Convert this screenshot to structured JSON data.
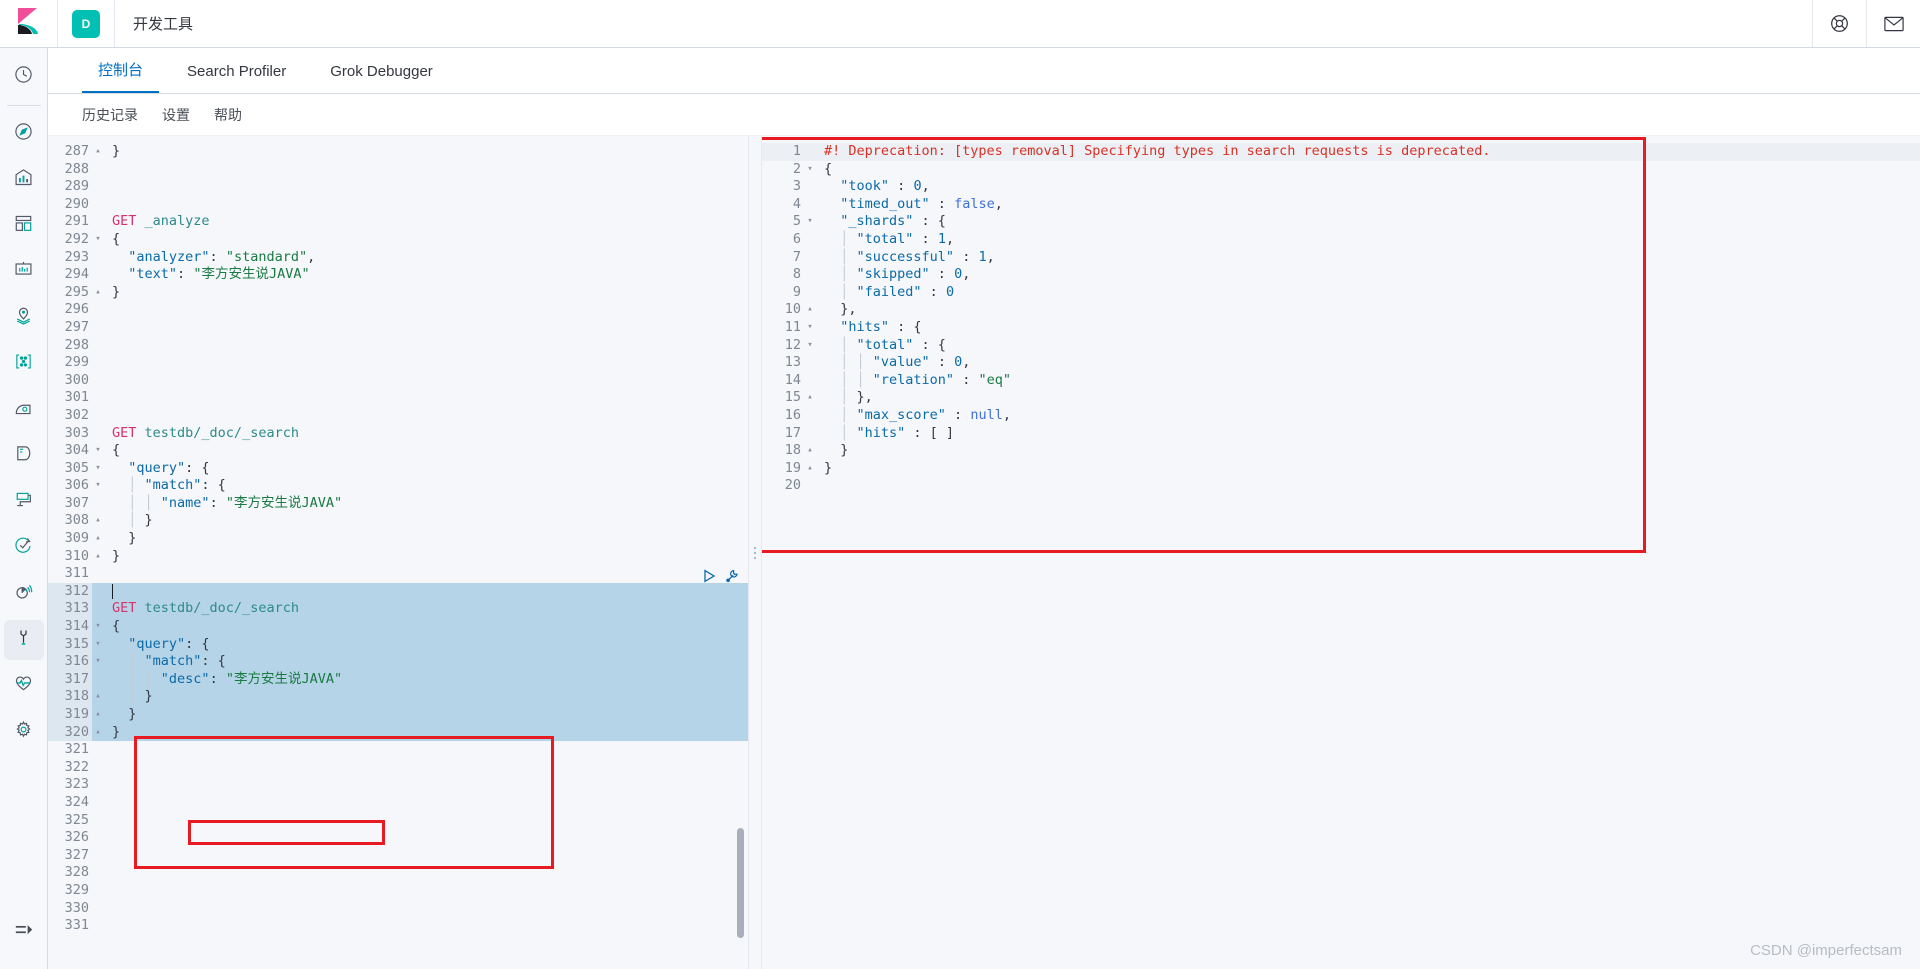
{
  "header": {
    "app_badge": "D",
    "app_title": "开发工具",
    "help_icon": "lifebuoy-icon",
    "mail_icon": "envelope-icon",
    "logo_icon": "kibana-logo-icon"
  },
  "rail": {
    "items": [
      {
        "name": "recently-viewed",
        "icon": "clock-icon"
      },
      {
        "name": "discover",
        "icon": "compass-icon"
      },
      {
        "name": "visualize",
        "icon": "bar-chart-icon"
      },
      {
        "name": "dashboard",
        "icon": "dashboard-grid-icon"
      },
      {
        "name": "canvas",
        "icon": "presentation-icon"
      },
      {
        "name": "maps",
        "icon": "map-pin-icon"
      },
      {
        "name": "machine-learning",
        "icon": "ml-nodes-icon"
      },
      {
        "name": "infrastructure",
        "icon": "infra-icon"
      },
      {
        "name": "logs",
        "icon": "logs-icon"
      },
      {
        "name": "apm",
        "icon": "apm-icon"
      },
      {
        "name": "uptime",
        "icon": "uptime-check-icon"
      },
      {
        "name": "siem",
        "icon": "siem-radar-icon"
      },
      {
        "name": "dev-tools",
        "icon": "wrench-icon",
        "active": true
      },
      {
        "name": "monitoring",
        "icon": "heartbeat-icon"
      },
      {
        "name": "management",
        "icon": "gear-icon"
      }
    ],
    "collapse": {
      "name": "collapse-nav",
      "icon": "collapse-arrow-icon"
    }
  },
  "tabs": [
    {
      "label": "控制台",
      "active": true
    },
    {
      "label": "Search Profiler",
      "active": false
    },
    {
      "label": "Grok Debugger",
      "active": false
    }
  ],
  "subnav": [
    {
      "label": "历史记录"
    },
    {
      "label": "设置"
    },
    {
      "label": "帮助"
    }
  ],
  "request_editor": {
    "first_line_number": 287,
    "lines": [
      {
        "n": 287,
        "fold": "up",
        "tokens": [
          {
            "t": "punc",
            "v": "}"
          }
        ]
      },
      {
        "n": 288,
        "fold": "",
        "tokens": []
      },
      {
        "n": 289,
        "fold": "",
        "tokens": []
      },
      {
        "n": 290,
        "fold": "",
        "tokens": []
      },
      {
        "n": 291,
        "fold": "",
        "tokens": [
          {
            "t": "method",
            "v": "GET"
          },
          {
            "t": "plain",
            "v": " "
          },
          {
            "t": "url",
            "v": "_analyze"
          }
        ]
      },
      {
        "n": 292,
        "fold": "down",
        "tokens": [
          {
            "t": "punc",
            "v": "{"
          }
        ]
      },
      {
        "n": 293,
        "fold": "",
        "tokens": [
          {
            "t": "plain",
            "v": "  "
          },
          {
            "t": "key",
            "v": "\"analyzer\""
          },
          {
            "t": "punc",
            "v": ": "
          },
          {
            "t": "str",
            "v": "\"standard\""
          },
          {
            "t": "punc",
            "v": ","
          }
        ]
      },
      {
        "n": 294,
        "fold": "",
        "tokens": [
          {
            "t": "plain",
            "v": "  "
          },
          {
            "t": "key",
            "v": "\"text\""
          },
          {
            "t": "punc",
            "v": ": "
          },
          {
            "t": "str",
            "v": "\"李方安生说JAVA\""
          }
        ]
      },
      {
        "n": 295,
        "fold": "up",
        "tokens": [
          {
            "t": "punc",
            "v": "}"
          }
        ]
      },
      {
        "n": 296,
        "fold": "",
        "tokens": []
      },
      {
        "n": 297,
        "fold": "",
        "tokens": []
      },
      {
        "n": 298,
        "fold": "",
        "tokens": []
      },
      {
        "n": 299,
        "fold": "",
        "tokens": []
      },
      {
        "n": 300,
        "fold": "",
        "tokens": []
      },
      {
        "n": 301,
        "fold": "",
        "tokens": []
      },
      {
        "n": 302,
        "fold": "",
        "tokens": []
      },
      {
        "n": 303,
        "fold": "",
        "tokens": [
          {
            "t": "method",
            "v": "GET"
          },
          {
            "t": "plain",
            "v": " "
          },
          {
            "t": "url",
            "v": "testdb/_doc/_search"
          }
        ]
      },
      {
        "n": 304,
        "fold": "down",
        "tokens": [
          {
            "t": "punc",
            "v": "{"
          }
        ]
      },
      {
        "n": 305,
        "fold": "down",
        "tokens": [
          {
            "t": "plain",
            "v": "  "
          },
          {
            "t": "key",
            "v": "\"query\""
          },
          {
            "t": "punc",
            "v": ": {"
          }
        ]
      },
      {
        "n": 306,
        "fold": "down",
        "tokens": [
          {
            "t": "guide",
            "v": "  │ "
          },
          {
            "t": "key",
            "v": "\"match\""
          },
          {
            "t": "punc",
            "v": ": {"
          }
        ]
      },
      {
        "n": 307,
        "fold": "",
        "tokens": [
          {
            "t": "guide",
            "v": "  │ │ "
          },
          {
            "t": "key",
            "v": "\"name\""
          },
          {
            "t": "punc",
            "v": ": "
          },
          {
            "t": "str",
            "v": "\"李方安生说JAVA\""
          }
        ]
      },
      {
        "n": 308,
        "fold": "up",
        "tokens": [
          {
            "t": "guide",
            "v": "  │ "
          },
          {
            "t": "punc",
            "v": "}"
          }
        ]
      },
      {
        "n": 309,
        "fold": "up",
        "tokens": [
          {
            "t": "plain",
            "v": "  "
          },
          {
            "t": "punc",
            "v": "}"
          }
        ]
      },
      {
        "n": 310,
        "fold": "up",
        "tokens": [
          {
            "t": "punc",
            "v": "}"
          }
        ]
      },
      {
        "n": 311,
        "fold": "",
        "tokens": []
      },
      {
        "n": 312,
        "fold": "",
        "tokens": [],
        "selected": true,
        "cursor": true
      },
      {
        "n": 313,
        "fold": "",
        "tokens": [
          {
            "t": "method",
            "v": "GET"
          },
          {
            "t": "plain",
            "v": " "
          },
          {
            "t": "url",
            "v": "testdb/_doc/_search"
          }
        ],
        "selected": true
      },
      {
        "n": 314,
        "fold": "down",
        "tokens": [
          {
            "t": "punc",
            "v": "{"
          }
        ],
        "selected": true
      },
      {
        "n": 315,
        "fold": "down",
        "tokens": [
          {
            "t": "plain",
            "v": "  "
          },
          {
            "t": "key",
            "v": "\"query\""
          },
          {
            "t": "punc",
            "v": ": {"
          }
        ],
        "selected": true
      },
      {
        "n": 316,
        "fold": "down",
        "tokens": [
          {
            "t": "guide",
            "v": "  │ "
          },
          {
            "t": "key",
            "v": "\"match\""
          },
          {
            "t": "punc",
            "v": ": {"
          }
        ],
        "selected": true
      },
      {
        "n": 317,
        "fold": "",
        "tokens": [
          {
            "t": "guide",
            "v": "  │ │ "
          },
          {
            "t": "key",
            "v": "\"desc\""
          },
          {
            "t": "punc",
            "v": ": "
          },
          {
            "t": "str",
            "v": "\"李方安生说JAVA\""
          }
        ],
        "selected": true
      },
      {
        "n": 318,
        "fold": "up",
        "tokens": [
          {
            "t": "guide",
            "v": "  │ "
          },
          {
            "t": "punc",
            "v": "}"
          }
        ],
        "selected": true
      },
      {
        "n": 319,
        "fold": "up",
        "tokens": [
          {
            "t": "plain",
            "v": "  "
          },
          {
            "t": "punc",
            "v": "}"
          }
        ],
        "selected": true
      },
      {
        "n": 320,
        "fold": "up",
        "tokens": [
          {
            "t": "punc",
            "v": "}"
          }
        ],
        "selected": true
      },
      {
        "n": 321,
        "fold": "",
        "tokens": []
      },
      {
        "n": 322,
        "fold": "",
        "tokens": []
      },
      {
        "n": 323,
        "fold": "",
        "tokens": []
      },
      {
        "n": 324,
        "fold": "",
        "tokens": []
      },
      {
        "n": 325,
        "fold": "",
        "tokens": []
      },
      {
        "n": 326,
        "fold": "",
        "tokens": []
      },
      {
        "n": 327,
        "fold": "",
        "tokens": []
      },
      {
        "n": 328,
        "fold": "",
        "tokens": []
      },
      {
        "n": 329,
        "fold": "",
        "tokens": []
      },
      {
        "n": 330,
        "fold": "",
        "tokens": []
      },
      {
        "n": 331,
        "fold": "",
        "tokens": []
      }
    ],
    "actions": [
      {
        "name": "send-request-button",
        "icon": "play-triangle-icon"
      },
      {
        "name": "request-options-button",
        "icon": "wrench-icon"
      }
    ]
  },
  "response_editor": {
    "lines": [
      {
        "n": 1,
        "fold": "",
        "deprecation": true,
        "tokens": [
          {
            "t": "warn",
            "v": "#! Deprecation: [types removal] Specifying types in search requests is deprecated."
          }
        ]
      },
      {
        "n": 2,
        "fold": "down",
        "tokens": [
          {
            "t": "punc",
            "v": "{"
          }
        ]
      },
      {
        "n": 3,
        "fold": "",
        "tokens": [
          {
            "t": "plain",
            "v": "  "
          },
          {
            "t": "key",
            "v": "\"took\""
          },
          {
            "t": "punc",
            "v": " : "
          },
          {
            "t": "num",
            "v": "0"
          },
          {
            "t": "punc",
            "v": ","
          }
        ]
      },
      {
        "n": 4,
        "fold": "",
        "tokens": [
          {
            "t": "plain",
            "v": "  "
          },
          {
            "t": "key",
            "v": "\"timed_out\""
          },
          {
            "t": "punc",
            "v": " : "
          },
          {
            "t": "bool",
            "v": "false"
          },
          {
            "t": "punc",
            "v": ","
          }
        ]
      },
      {
        "n": 5,
        "fold": "down",
        "tokens": [
          {
            "t": "plain",
            "v": "  "
          },
          {
            "t": "key",
            "v": "\"_shards\""
          },
          {
            "t": "punc",
            "v": " : {"
          }
        ]
      },
      {
        "n": 6,
        "fold": "",
        "tokens": [
          {
            "t": "guide",
            "v": "  │ "
          },
          {
            "t": "key",
            "v": "\"total\""
          },
          {
            "t": "punc",
            "v": " : "
          },
          {
            "t": "num",
            "v": "1"
          },
          {
            "t": "punc",
            "v": ","
          }
        ]
      },
      {
        "n": 7,
        "fold": "",
        "tokens": [
          {
            "t": "guide",
            "v": "  │ "
          },
          {
            "t": "key",
            "v": "\"successful\""
          },
          {
            "t": "punc",
            "v": " : "
          },
          {
            "t": "num",
            "v": "1"
          },
          {
            "t": "punc",
            "v": ","
          }
        ]
      },
      {
        "n": 8,
        "fold": "",
        "tokens": [
          {
            "t": "guide",
            "v": "  │ "
          },
          {
            "t": "key",
            "v": "\"skipped\""
          },
          {
            "t": "punc",
            "v": " : "
          },
          {
            "t": "num",
            "v": "0"
          },
          {
            "t": "punc",
            "v": ","
          }
        ]
      },
      {
        "n": 9,
        "fold": "",
        "tokens": [
          {
            "t": "guide",
            "v": "  │ "
          },
          {
            "t": "key",
            "v": "\"failed\""
          },
          {
            "t": "punc",
            "v": " : "
          },
          {
            "t": "num",
            "v": "0"
          }
        ]
      },
      {
        "n": 10,
        "fold": "up",
        "tokens": [
          {
            "t": "plain",
            "v": "  "
          },
          {
            "t": "punc",
            "v": "},"
          }
        ]
      },
      {
        "n": 11,
        "fold": "down",
        "tokens": [
          {
            "t": "plain",
            "v": "  "
          },
          {
            "t": "key",
            "v": "\"hits\""
          },
          {
            "t": "punc",
            "v": " : {"
          }
        ]
      },
      {
        "n": 12,
        "fold": "down",
        "tokens": [
          {
            "t": "guide",
            "v": "  │ "
          },
          {
            "t": "key",
            "v": "\"total\""
          },
          {
            "t": "punc",
            "v": " : {"
          }
        ]
      },
      {
        "n": 13,
        "fold": "",
        "tokens": [
          {
            "t": "guide",
            "v": "  │ │ "
          },
          {
            "t": "key",
            "v": "\"value\""
          },
          {
            "t": "punc",
            "v": " : "
          },
          {
            "t": "num",
            "v": "0"
          },
          {
            "t": "punc",
            "v": ","
          }
        ]
      },
      {
        "n": 14,
        "fold": "",
        "tokens": [
          {
            "t": "guide",
            "v": "  │ │ "
          },
          {
            "t": "key",
            "v": "\"relation\""
          },
          {
            "t": "punc",
            "v": " : "
          },
          {
            "t": "str",
            "v": "\"eq\""
          }
        ]
      },
      {
        "n": 15,
        "fold": "up",
        "tokens": [
          {
            "t": "guide",
            "v": "  │ "
          },
          {
            "t": "punc",
            "v": "},"
          }
        ]
      },
      {
        "n": 16,
        "fold": "",
        "tokens": [
          {
            "t": "guide",
            "v": "  │ "
          },
          {
            "t": "key",
            "v": "\"max_score\""
          },
          {
            "t": "punc",
            "v": " : "
          },
          {
            "t": "bool",
            "v": "null"
          },
          {
            "t": "punc",
            "v": ","
          }
        ]
      },
      {
        "n": 17,
        "fold": "",
        "tokens": [
          {
            "t": "guide",
            "v": "  │ "
          },
          {
            "t": "key",
            "v": "\"hits\""
          },
          {
            "t": "punc",
            "v": " : [ ]"
          }
        ]
      },
      {
        "n": 18,
        "fold": "up",
        "tokens": [
          {
            "t": "plain",
            "v": "  "
          },
          {
            "t": "punc",
            "v": "}"
          }
        ]
      },
      {
        "n": 19,
        "fold": "up",
        "tokens": [
          {
            "t": "punc",
            "v": "}"
          }
        ]
      },
      {
        "n": 20,
        "fold": "",
        "tokens": []
      }
    ]
  },
  "annotations": [
    {
      "name": "annotation-response-box"
    },
    {
      "name": "annotation-request-box"
    },
    {
      "name": "annotation-desc-field-box"
    }
  ],
  "watermark": "CSDN @imperfectsam",
  "colors": {
    "accent": "#0071c2",
    "badge": "#00bfb3",
    "selection": "#b6d4e8",
    "annotation": "#e81b23",
    "method": "#d6336c",
    "string": "#1a7a43",
    "key": "#0b6aa8",
    "warning": "#d93025"
  }
}
